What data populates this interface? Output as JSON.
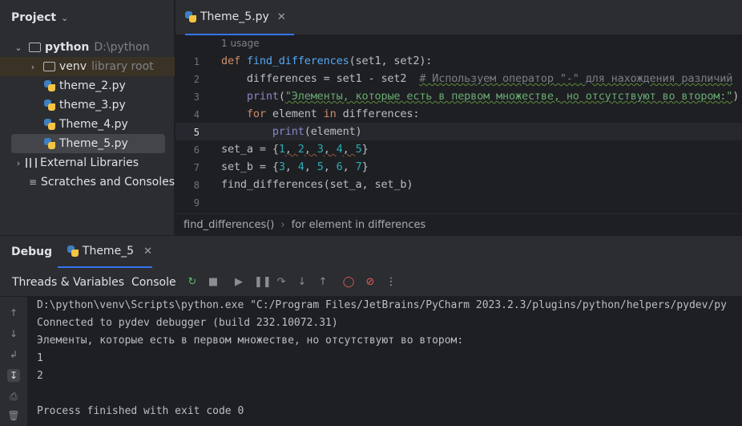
{
  "project": {
    "title": "Project",
    "root": {
      "name": "python",
      "path": "D:\\python"
    },
    "venv": {
      "name": "venv",
      "note": "library root"
    },
    "files": [
      "theme_2.py",
      "theme_3.py",
      "Theme_4.py",
      "Theme_5.py"
    ],
    "external_libraries": "External Libraries",
    "scratches": "Scratches and Consoles"
  },
  "editor": {
    "tab_label": "Theme_5.py",
    "usage_hint": "1 usage",
    "line_numbers": [
      "1",
      "2",
      "3",
      "4",
      "5",
      "6",
      "7",
      "8",
      "9"
    ],
    "code": {
      "l1_def": "def",
      "l1_fn": "find_differences",
      "l1_rest": "(set1, set2):",
      "l2_code": "    differences = set1 - set2  ",
      "l2_comment": "# Используем оператор \"-\" для нахождения различий",
      "l3_print": "print",
      "l3_open": "(",
      "l3_str": "\"Элементы, которые есть в первом множестве, но отсутствуют во втором:\"",
      "l3_close": ")",
      "l4_for": "for",
      "l4_mid": " element ",
      "l4_in": "in",
      "l4_rest": " differences:",
      "l5_print": "print",
      "l5_rest": "(element)",
      "l6_a": "set_a = {",
      "l6_nums": [
        "1",
        "2",
        "3",
        "4",
        "5"
      ],
      "l6_end": "}",
      "l7_a": "set_b = {",
      "l7_nums": [
        "3",
        "4",
        "5",
        "6",
        "7"
      ],
      "l7_end": "}",
      "l8": "find_differences(set_a, set_b)"
    }
  },
  "breadcrumbs": [
    "find_differences()",
    "for element in differences"
  ],
  "debug": {
    "title": "Debug",
    "session_tab": "Theme_5",
    "tabs": {
      "threads": "Threads & Variables",
      "console": "Console"
    },
    "console_lines": [
      "D:\\python\\venv\\Scripts\\python.exe \"C:/Program Files/JetBrains/PyCharm 2023.2.3/plugins/python/helpers/pydev/py",
      "Connected to pydev debugger (build 232.10072.31)",
      "Элементы, которые есть в первом множестве, но отсутствуют во втором:",
      "1",
      "2",
      "",
      "Process finished with exit code 0"
    ]
  },
  "colors": {
    "accent": "#3574f0",
    "keyword": "#cf8e6d",
    "function": "#56a8f5",
    "string": "#6aab73",
    "number": "#2aacb8",
    "stop_red": "#e55c5c"
  }
}
